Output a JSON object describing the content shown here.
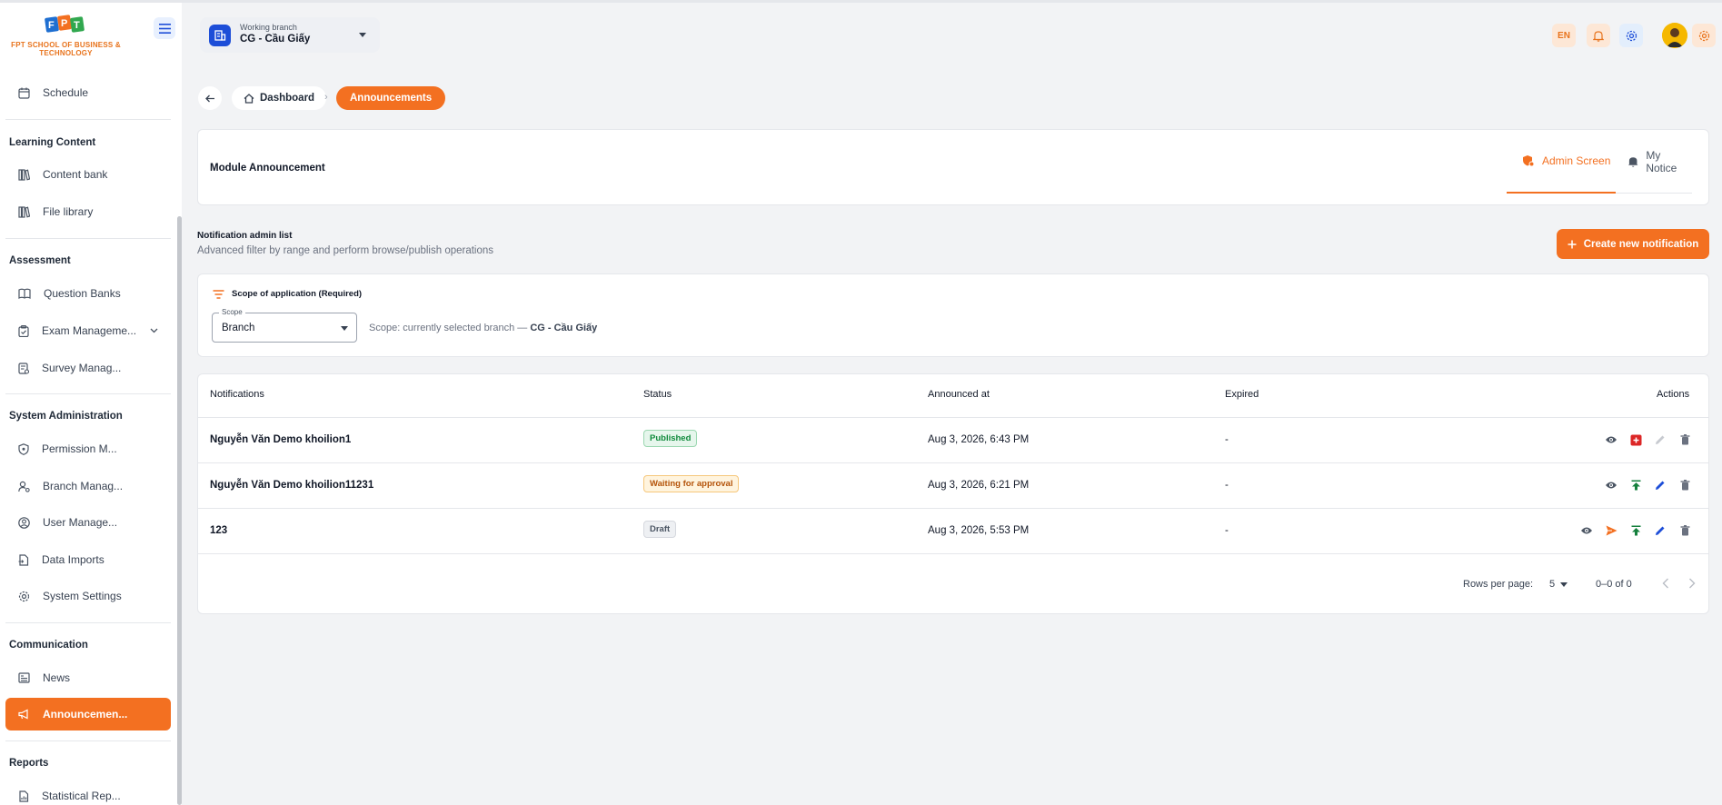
{
  "sidebar": {
    "logo_text": "FPT SCHOOL OF BUSINESS & TECHNOLOGY",
    "schedule": "Schedule",
    "sections": {
      "learning": "Learning Content",
      "assessment": "Assessment",
      "sysadmin": "System Administration",
      "communication": "Communication",
      "reports": "Reports"
    },
    "items": {
      "content_bank": "Content bank",
      "file_library": "File library",
      "question_banks": "Question Banks",
      "exam_management": "Exam Manageme...",
      "survey_management": "Survey Manag...",
      "permission": "Permission M...",
      "branch": "Branch Manag...",
      "user": "User Manage...",
      "data_imports": "Data Imports",
      "system_settings": "System Settings",
      "news": "News",
      "announcements": "Announcemen...",
      "statistical": "Statistical Rep..."
    }
  },
  "topbar": {
    "branch_caption": "Working branch",
    "branch_value": "CG - Cầu Giấy",
    "lang": "EN"
  },
  "breadcrumb": {
    "home": "Dashboard",
    "current": "Announcements"
  },
  "module": {
    "title": "Module Announcement",
    "tab_admin": "Admin Screen",
    "tab_notice": "My Notice"
  },
  "list": {
    "title": "Notification admin list",
    "subtitle": "Advanced filter by range and perform browse/publish operations",
    "create_label": "Create new notification"
  },
  "scope": {
    "header": "Scope of application (Required)",
    "select_label": "Scope",
    "select_value": "Branch",
    "note_prefix": "Scope: currently selected branch —",
    "note_branch": "CG - Cầu Giấy"
  },
  "table": {
    "headers": {
      "notifications": "Notifications",
      "status": "Status",
      "announced": "Announced at",
      "expired": "Expired",
      "actions": "Actions"
    },
    "rows": [
      {
        "name": "Nguyễn Văn Demo khoilion1",
        "status": "Published",
        "announced": "Aug 3, 2026, 6:43 PM",
        "expired": "-"
      },
      {
        "name": "Nguyễn Văn Demo khoilion11231",
        "status": "Waiting for approval",
        "announced": "Aug 3, 2026, 6:21 PM",
        "expired": "-"
      },
      {
        "name": "123",
        "status": "Draft",
        "announced": "Aug 3, 2026, 5:53 PM",
        "expired": "-"
      }
    ]
  },
  "pagination": {
    "rows_label": "Rows per page:",
    "rows_value": "5",
    "range": "0–0 of 0"
  },
  "colors": {
    "accent": "#f37021",
    "brand_blue": "#1d4ed8",
    "published": "#0f8a3b",
    "waiting": "#b45309"
  },
  "icons": [
    "menu-icon",
    "building-icon",
    "bell-icon",
    "gear-icon",
    "home-icon",
    "back-arrow-icon",
    "plus-icon",
    "filter-icon",
    "eye-icon",
    "unpublish-icon",
    "publish-icon",
    "send-icon",
    "edit-icon",
    "trash-icon",
    "chevron-left-icon",
    "chevron-right-icon"
  ]
}
